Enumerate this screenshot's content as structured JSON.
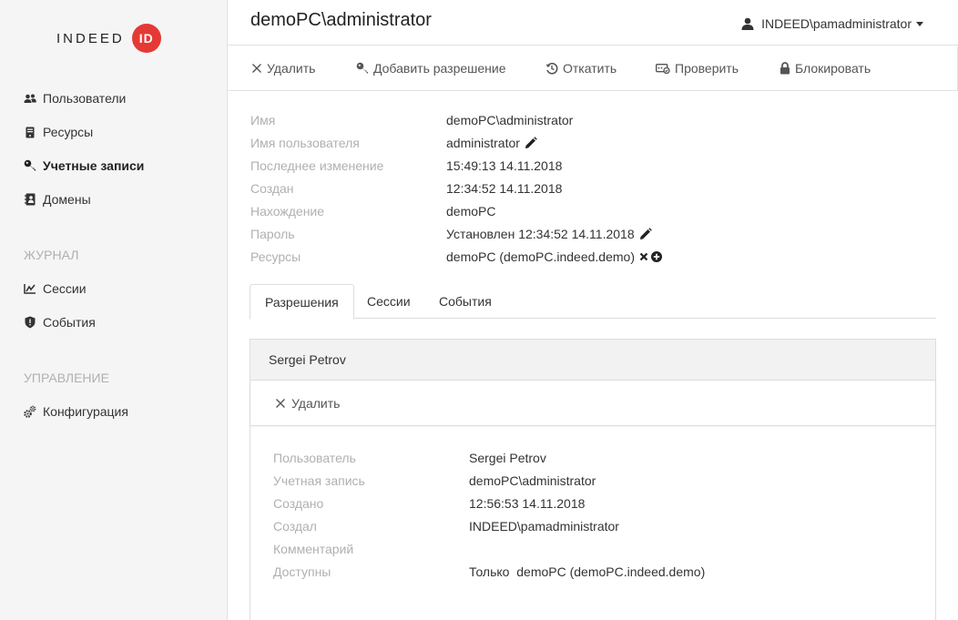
{
  "brand": {
    "logo_text": "INDEED",
    "logo_badge": "ID",
    "accent": "#e53935"
  },
  "sidebar": {
    "items": [
      {
        "label": "Пользователи",
        "icon": "users-icon"
      },
      {
        "label": "Ресурсы",
        "icon": "server-icon"
      },
      {
        "label": "Учетные записи",
        "icon": "key-icon",
        "active": true
      },
      {
        "label": "Домены",
        "icon": "address-book-icon"
      }
    ],
    "section_journal": "ЖУРНАЛ",
    "journal_items": [
      {
        "label": "Сессии",
        "icon": "sessions-icon"
      },
      {
        "label": "События",
        "icon": "shield-icon"
      }
    ],
    "section_manage": "УПРАВЛЕНИЕ",
    "manage_items": [
      {
        "label": "Конфигурация",
        "icon": "gears-icon"
      }
    ]
  },
  "header": {
    "title": "demoPC\\administrator",
    "user": "INDEED\\pamadministrator"
  },
  "toolbar": {
    "delete": "Удалить",
    "add_permission": "Добавить разрешение",
    "rollback": "Откатить",
    "check": "Проверить",
    "block": "Блокировать"
  },
  "props": [
    {
      "label": "Имя",
      "value": "demoPC\\administrator"
    },
    {
      "label": "Имя пользователя",
      "value": "administrator"
    },
    {
      "label": "Последнее изменение",
      "value": "15:49:13 14.11.2018"
    },
    {
      "label": "Создан",
      "value": "12:34:52 14.11.2018"
    },
    {
      "label": "Нахождение",
      "value": "demoPC"
    },
    {
      "label": "Пароль",
      "value": "Установлен 12:34:52 14.11.2018"
    },
    {
      "label": "Ресурсы",
      "value": "demoPC (demoPC.indeed.demo)"
    }
  ],
  "tabs": [
    "Разрешения",
    "Сессии",
    "События"
  ],
  "permission": {
    "title": "Sergei Petrov",
    "delete": "Удалить",
    "details": [
      {
        "label": "Пользователь",
        "value": "Sergei Petrov"
      },
      {
        "label": "Учетная запись",
        "value": "demoPC\\administrator"
      },
      {
        "label": "Создано",
        "value": "12:56:53 14.11.2018"
      },
      {
        "label": "Создал",
        "value": "INDEED\\pamadministrator"
      },
      {
        "label": "Комментарий",
        "value": ""
      },
      {
        "label": "Доступны",
        "value": "Только  demoPC (demoPC.indeed.demo)"
      }
    ]
  }
}
